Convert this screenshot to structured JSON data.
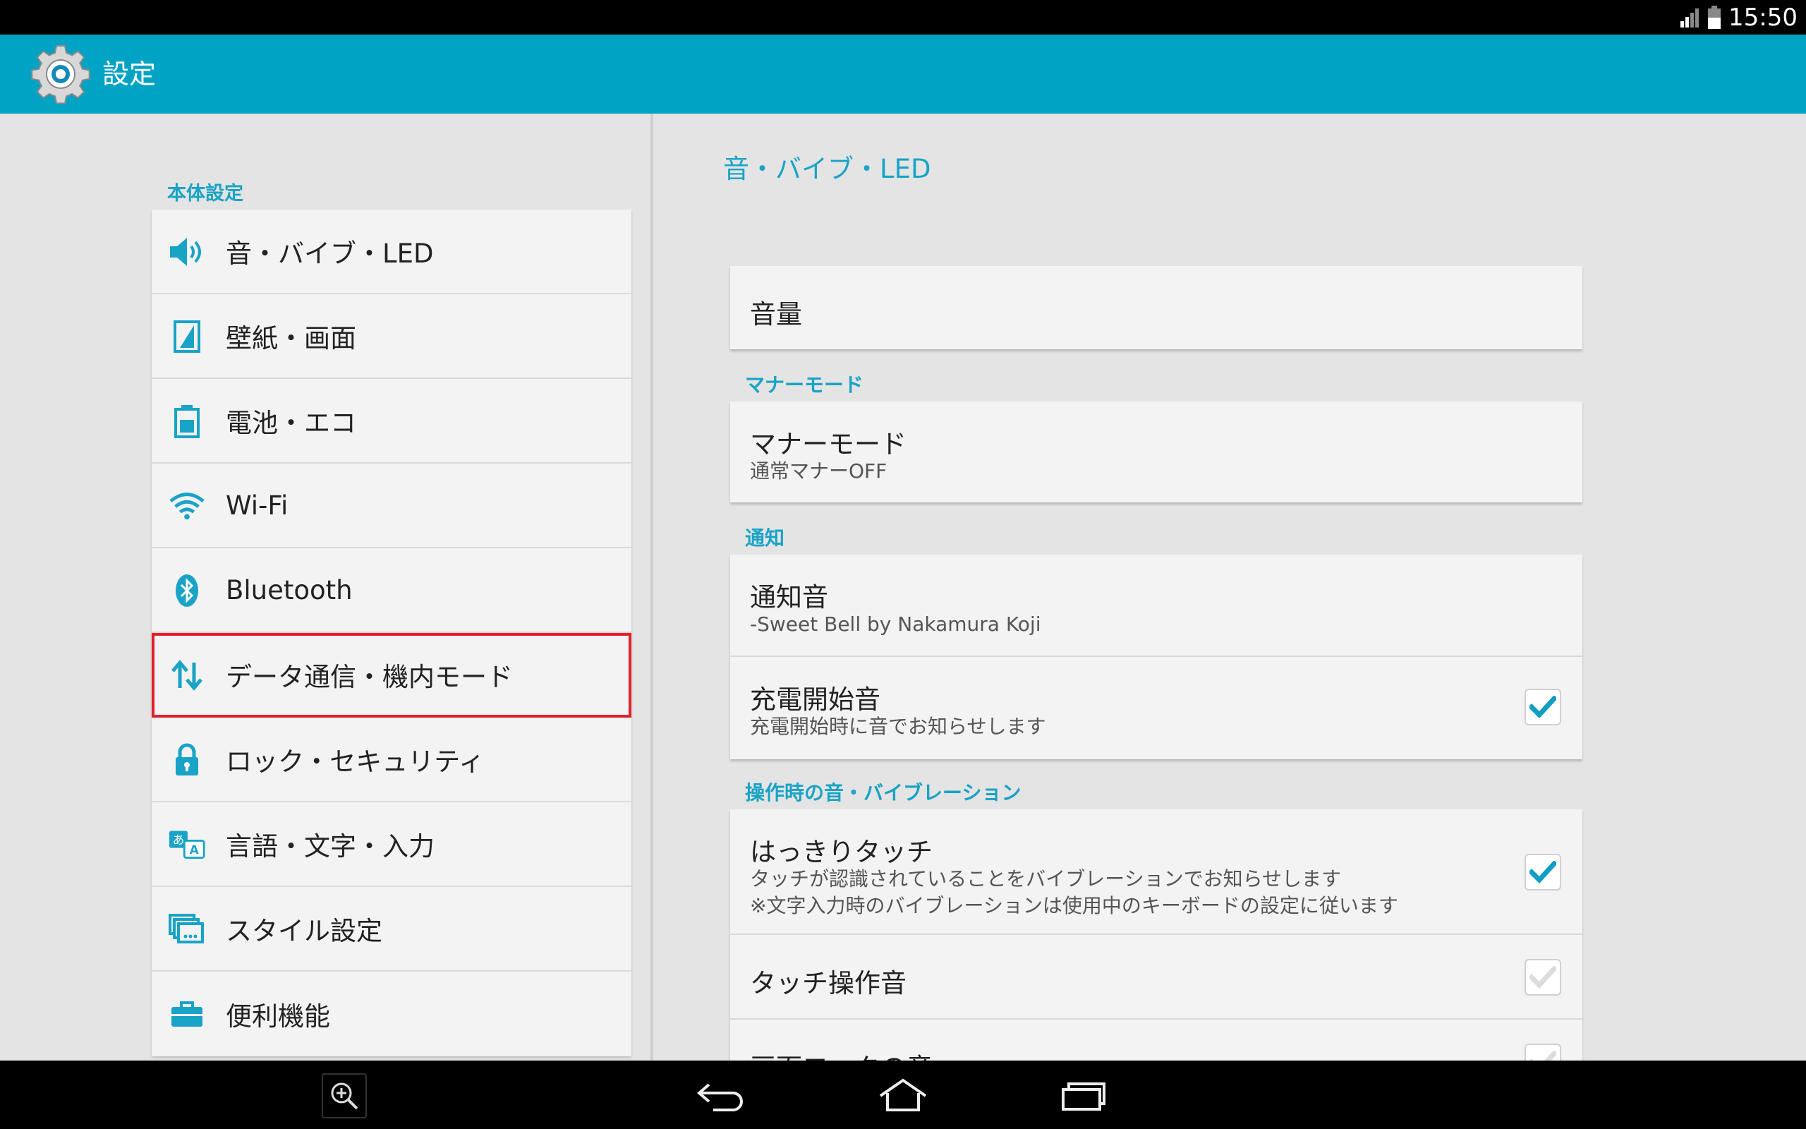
{
  "status_bar": {
    "time": "15:50"
  },
  "action_bar": {
    "title": "設定"
  },
  "left": {
    "section": "本体設定",
    "items": [
      {
        "label": "音・バイブ・LED",
        "icon": "speaker-icon"
      },
      {
        "label": "壁紙・画面",
        "icon": "wallpaper-icon"
      },
      {
        "label": "電池・エコ",
        "icon": "battery-icon"
      },
      {
        "label": "Wi-Fi",
        "icon": "wifi-icon"
      },
      {
        "label": "Bluetooth",
        "icon": "bluetooth-icon"
      },
      {
        "label": "データ通信・機内モード",
        "icon": "data-transfer-icon",
        "selected": true
      },
      {
        "label": "ロック・セキュリティ",
        "icon": "lock-icon"
      },
      {
        "label": "言語・文字・入力",
        "icon": "language-icon"
      },
      {
        "label": "スタイル設定",
        "icon": "style-icon"
      },
      {
        "label": "便利機能",
        "icon": "toolbox-icon"
      }
    ]
  },
  "right": {
    "heading": "音・バイブ・LED",
    "volume": {
      "title": "音量"
    },
    "manner": {
      "category": "マナーモード",
      "title": "マナーモード",
      "summary": "通常マナーOFF"
    },
    "notification": {
      "category": "通知",
      "sound_title": "通知音",
      "sound_summary": "-Sweet Bell by Nakamura Koji",
      "charge_title": "充電開始音",
      "charge_summary": "充電開始時に音でお知らせします",
      "charge_checked": true
    },
    "operation": {
      "category": "操作時の音・バイブレーション",
      "clear_touch_title": "はっきりタッチ",
      "clear_touch_summary1": "タッチが認識されていることをバイブレーションでお知らせします",
      "clear_touch_summary2": "※文字入力時のバイブレーションは使用中のキーボードの設定に従います",
      "clear_touch_checked": true,
      "touch_sound_title": "タッチ操作音",
      "touch_sound_checked": false,
      "screen_lock_title": "画面ロックの音"
    }
  },
  "colors": {
    "accent": "#00a3c4",
    "text_accent": "#19a3c6",
    "selection_outline": "#e1202b"
  }
}
